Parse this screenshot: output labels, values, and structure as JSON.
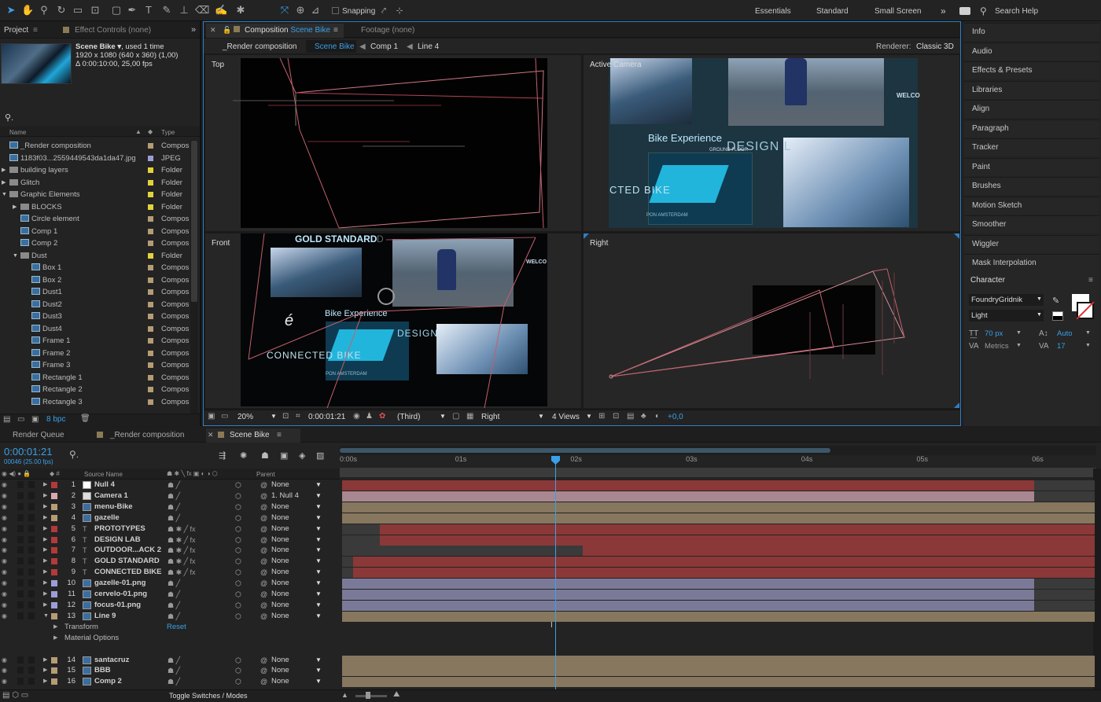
{
  "toolbar": {
    "snapping": "Snapping",
    "workspaces": [
      "Essentials",
      "Standard",
      "Small Screen"
    ],
    "more": "»",
    "search_placeholder": "Search Help"
  },
  "project": {
    "tab_label": "Project",
    "effect_controls": "Effect Controls (none)",
    "thumb_name": "Scene Bike ▾",
    "thumb_used": ", used 1 time",
    "thumb_dims": "1920 x 1080  (640 x 360) (1,00)",
    "thumb_dur": "Δ 0:00:10:00, 25,00 fps",
    "col_name": "Name",
    "col_type": "Type",
    "bpc": "8 bpc",
    "items": [
      {
        "name": "_Render composition",
        "type": "Compos",
        "indent": 0,
        "arrow": "",
        "kind": "comp",
        "color": "#b59c75"
      },
      {
        "name": "1183f03...2559449543da1da47.jpg",
        "type": "JPEG",
        "indent": 0,
        "arrow": "",
        "kind": "img",
        "color": "#9d9dd6"
      },
      {
        "name": "building layers",
        "type": "Folder",
        "indent": 0,
        "arrow": "▶",
        "kind": "folder",
        "color": "#e3d23c"
      },
      {
        "name": "Glitch",
        "type": "Folder",
        "indent": 0,
        "arrow": "▶",
        "kind": "folder",
        "color": "#e3d23c"
      },
      {
        "name": "Graphic Elements",
        "type": "Folder",
        "indent": 0,
        "arrow": "▼",
        "kind": "folder",
        "color": "#e3d23c"
      },
      {
        "name": "BLOCKS",
        "type": "Folder",
        "indent": 1,
        "arrow": "▶",
        "kind": "folder",
        "color": "#e3d23c"
      },
      {
        "name": "Circle element",
        "type": "Compos",
        "indent": 1,
        "arrow": "",
        "kind": "comp",
        "color": "#b59c75"
      },
      {
        "name": "Comp 1",
        "type": "Compos",
        "indent": 1,
        "arrow": "",
        "kind": "comp",
        "color": "#b59c75"
      },
      {
        "name": "Comp 2",
        "type": "Compos",
        "indent": 1,
        "arrow": "",
        "kind": "comp",
        "color": "#b59c75"
      },
      {
        "name": "Dust",
        "type": "Folder",
        "indent": 1,
        "arrow": "▼",
        "kind": "folder",
        "color": "#e3d23c"
      },
      {
        "name": "Box 1",
        "type": "Compos",
        "indent": 2,
        "arrow": "",
        "kind": "comp",
        "color": "#b59c75"
      },
      {
        "name": "Box 2",
        "type": "Compos",
        "indent": 2,
        "arrow": "",
        "kind": "comp",
        "color": "#b59c75"
      },
      {
        "name": "Dust1",
        "type": "Compos",
        "indent": 2,
        "arrow": "",
        "kind": "comp",
        "color": "#b59c75"
      },
      {
        "name": "Dust2",
        "type": "Compos",
        "indent": 2,
        "arrow": "",
        "kind": "comp",
        "color": "#b59c75"
      },
      {
        "name": "Dust3",
        "type": "Compos",
        "indent": 2,
        "arrow": "",
        "kind": "comp",
        "color": "#b59c75"
      },
      {
        "name": "Dust4",
        "type": "Compos",
        "indent": 2,
        "arrow": "",
        "kind": "comp",
        "color": "#b59c75"
      },
      {
        "name": "Frame 1",
        "type": "Compos",
        "indent": 2,
        "arrow": "",
        "kind": "comp",
        "color": "#b59c75"
      },
      {
        "name": "Frame 2",
        "type": "Compos",
        "indent": 2,
        "arrow": "",
        "kind": "comp",
        "color": "#b59c75"
      },
      {
        "name": "Frame 3",
        "type": "Compos",
        "indent": 2,
        "arrow": "",
        "kind": "comp",
        "color": "#b59c75"
      },
      {
        "name": "Rectangle 1",
        "type": "Compos",
        "indent": 2,
        "arrow": "",
        "kind": "comp",
        "color": "#b59c75"
      },
      {
        "name": "Rectangle 2",
        "type": "Compos",
        "indent": 2,
        "arrow": "",
        "kind": "comp",
        "color": "#b59c75"
      },
      {
        "name": "Rectangle 3",
        "type": "Compos",
        "indent": 2,
        "arrow": "",
        "kind": "comp",
        "color": "#b59c75"
      }
    ]
  },
  "viewer": {
    "tab_prefix": "Composition",
    "tab_name": "Scene Bike",
    "footage": "Footage (none)",
    "crumbs": [
      "_Render composition",
      "Scene Bike",
      "Comp 1",
      "Line 4"
    ],
    "renderer_label": "Renderer:",
    "renderer": "Classic 3D",
    "views": {
      "top": "Top",
      "active": "Active Camera",
      "front": "Front",
      "right": "Right"
    },
    "texts": {
      "bike_exp": "Bike Experience",
      "design": "DESIGN L",
      "connected": "CTED BIKE",
      "pon": "PON AMSTERDAM",
      "ground": "GROUND FLOOR",
      "welc": "WELCO",
      "gold": "GOLD STANDARD",
      "gold_tail": "D",
      "design2": "DESIGN",
      "connected2": "CONNECTED BIKE",
      "e": "é"
    },
    "bottom": {
      "zoom": "20%",
      "time": "0:00:01:21",
      "camera": "(Third)",
      "view": "Right",
      "layout": "4 Views",
      "exposure": "+0,0"
    }
  },
  "panels": {
    "items": [
      "Info",
      "Audio",
      "Effects & Presets",
      "Libraries",
      "Align",
      "Paragraph",
      "Tracker",
      "Paint",
      "Brushes",
      "Motion Sketch",
      "Smoother",
      "Wiggler",
      "Mask Interpolation"
    ],
    "character": {
      "title": "Character",
      "font": "FoundryGridnik",
      "style": "Light",
      "size": "70 px",
      "leading": "Auto",
      "kerning": "Metrics",
      "tracking": "17"
    }
  },
  "timeline": {
    "tabs": [
      "Render Queue",
      "_Render composition",
      "Scene Bike"
    ],
    "timecode": "0:00:01:21",
    "frames": "00046 (25.00 fps)",
    "col_source": "Source Name",
    "col_parent": "Parent",
    "ticks": [
      "0:00s",
      "01s",
      "02s",
      "03s",
      "04s",
      "05s",
      "06s"
    ],
    "toggle": "Toggle Switches / Modes",
    "reset": "Reset",
    "layers": [
      {
        "num": "1",
        "name": "Null 4",
        "parent": "None",
        "color": "#b23a3a",
        "icon": "null",
        "start": 0,
        "end": 1,
        "bar": "#8b3838"
      },
      {
        "num": "2",
        "name": "Camera 1",
        "parent": "1. Null 4",
        "color": "#dba6b3",
        "icon": "cam",
        "start": 0,
        "end": 1,
        "bar": "#a88790"
      },
      {
        "num": "3",
        "name": "menu-Bike",
        "parent": "None",
        "color": "#b59c75",
        "icon": "comp",
        "start": 0,
        "end": 1,
        "bar": "#86775e"
      },
      {
        "num": "4",
        "name": "gazelle",
        "parent": "None",
        "color": "#b59c75",
        "icon": "comp",
        "start": 0,
        "end": 1,
        "bar": "#86775e"
      },
      {
        "num": "5",
        "name": "PROTOTYPES",
        "parent": "None",
        "color": "#b23a3a",
        "icon": "text",
        "start": 0.05,
        "end": 1,
        "bar": "#8b3838"
      },
      {
        "num": "6",
        "name": "DESIGN LAB",
        "parent": "None",
        "color": "#b23a3a",
        "icon": "text",
        "start": 0.05,
        "end": 1,
        "bar": "#8b3838"
      },
      {
        "num": "7",
        "name": "OUTDOOR...ACK 2",
        "parent": "None",
        "color": "#b23a3a",
        "icon": "text",
        "start": 0.32,
        "end": 1,
        "bar": "#8b3838"
      },
      {
        "num": "8",
        "name": "GOLD STANDARD",
        "parent": "None",
        "color": "#b23a3a",
        "icon": "text",
        "start": 0.015,
        "end": 1,
        "bar": "#8b3838"
      },
      {
        "num": "9",
        "name": "CONNECTED BIKE",
        "parent": "None",
        "color": "#b23a3a",
        "icon": "text",
        "start": 0.015,
        "end": 1,
        "bar": "#8b3838"
      },
      {
        "num": "10",
        "name": "gazelle-01.png",
        "parent": "None",
        "color": "#9d9dd6",
        "icon": "img",
        "start": 0,
        "end": 1,
        "bar": "#7a7a98"
      },
      {
        "num": "11",
        "name": "cervelo-01.png",
        "parent": "None",
        "color": "#9d9dd6",
        "icon": "img",
        "start": 0,
        "end": 1,
        "bar": "#7a7a98"
      },
      {
        "num": "12",
        "name": "focus-01.png",
        "parent": "None",
        "color": "#9d9dd6",
        "icon": "img",
        "start": 0,
        "end": 1,
        "bar": "#7a7a98"
      },
      {
        "num": "13",
        "name": "Line 9",
        "parent": "None",
        "color": "#b59c75",
        "icon": "comp",
        "start": 0,
        "end": 1,
        "bar": "#86775e"
      },
      {
        "num": "14",
        "name": "santacruz",
        "parent": "None",
        "color": "#b59c75",
        "icon": "comp",
        "start": 0,
        "end": 1,
        "bar": "#86775e"
      },
      {
        "num": "15",
        "name": "BBB",
        "parent": "None",
        "color": "#b59c75",
        "icon": "comp",
        "start": 0,
        "end": 1,
        "bar": "#86775e"
      },
      {
        "num": "16",
        "name": "Comp 2",
        "parent": "None",
        "color": "#b59c75",
        "icon": "comp",
        "start": 0,
        "end": 1,
        "bar": "#86775e"
      }
    ],
    "subrows": [
      "Transform",
      "Material Options"
    ]
  }
}
